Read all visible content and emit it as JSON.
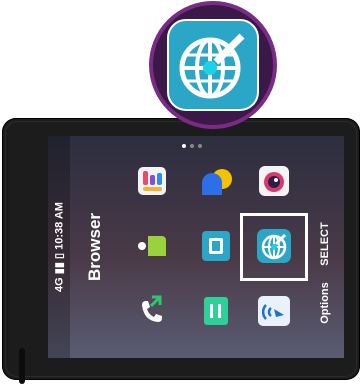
{
  "screen": {
    "status_bar": {
      "network": "4G",
      "signal": "signal-bars-icon",
      "battery": "battery-icon",
      "time": "10:38 AM"
    },
    "app_title": "Browser",
    "softkeys": {
      "right": "Options",
      "center": "SELECT"
    },
    "page_indicator": {
      "current": 1,
      "total": 3
    },
    "apps": [
      {
        "name": "gallery-app-icon"
      },
      {
        "name": "weather-app-icon"
      },
      {
        "name": "camera-app-icon"
      },
      {
        "name": "contacts-app-icon"
      },
      {
        "name": "sim-card-app-icon"
      },
      {
        "name": "browser-app-icon",
        "selected": true
      },
      {
        "name": "phone-call-app-icon"
      },
      {
        "name": "music-app-icon"
      },
      {
        "name": "fm-radio-app-icon"
      }
    ],
    "selected_app": "Browser"
  },
  "colors": {
    "browser_teal": "#2ba6c6",
    "callout_ring": "#7a2b86",
    "callout_bg": "#3a1848",
    "device_frame": "#1c1c1c"
  }
}
